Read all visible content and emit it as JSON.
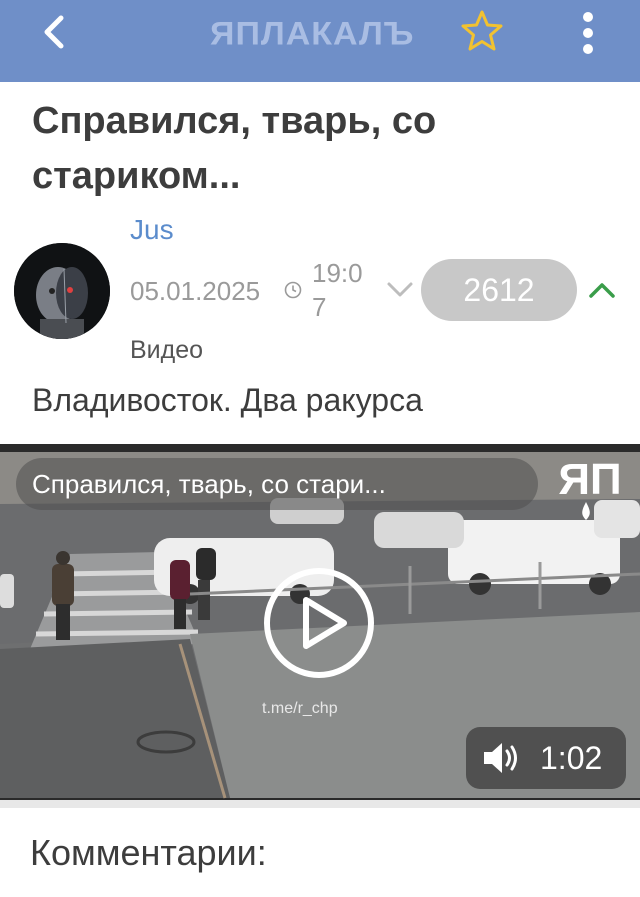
{
  "header": {
    "logo_text": "ЯПЛАКАЛЪ",
    "back_icon": "chevron-left-icon",
    "favorite_icon": "star-outline-icon",
    "menu_icon": "vertical-dots-icon",
    "bar_color": "#6f8fc8",
    "star_color": "#f2c230"
  },
  "post": {
    "title": "Справился, тварь, со стариком...",
    "author": "Jus",
    "date": "05.01.2025",
    "time": "19:07",
    "rating": "2612",
    "type_label": "Видео",
    "body": "Владивосток. Два ракурса"
  },
  "video": {
    "title": "Справился, тварь, со стари...",
    "logo_text": "ЯП",
    "watermark": "t.me/r_chp",
    "duration": "1:02"
  },
  "comments": {
    "title": "Комментарии:"
  },
  "colors": {
    "author_link": "#5b8ccc",
    "rating_pill": "#c8c8c8",
    "upvote": "#3a9d4a"
  }
}
